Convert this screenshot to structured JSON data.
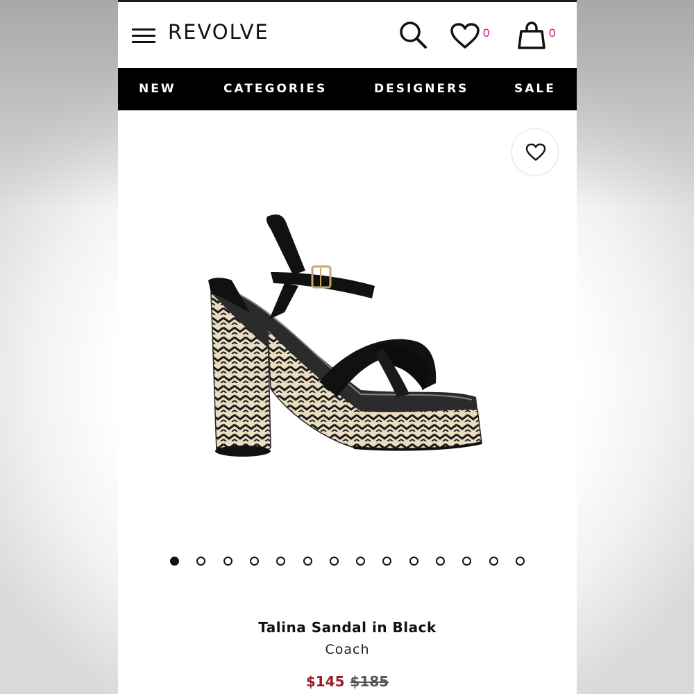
{
  "header": {
    "logo": "REVOLVE",
    "wishlist_count": "0",
    "bag_count": "0"
  },
  "nav": {
    "items": [
      {
        "label": "NEW"
      },
      {
        "label": "CATEGORIES"
      },
      {
        "label": "DESIGNERS"
      },
      {
        "label": "SALE"
      }
    ]
  },
  "gallery": {
    "total_images": 14,
    "active_index": 0
  },
  "product": {
    "name": "Talina Sandal in Black",
    "brand": "Coach",
    "sale_price": "$145",
    "original_price": "$185"
  },
  "colors": {
    "accent_count": "#c2187f",
    "sale_price": "#9b1c2c",
    "nav_bg": "#000000"
  },
  "icons": {
    "menu": "hamburger-icon",
    "search": "search-icon",
    "wishlist": "heart-icon",
    "bag": "shopping-bag-icon"
  }
}
